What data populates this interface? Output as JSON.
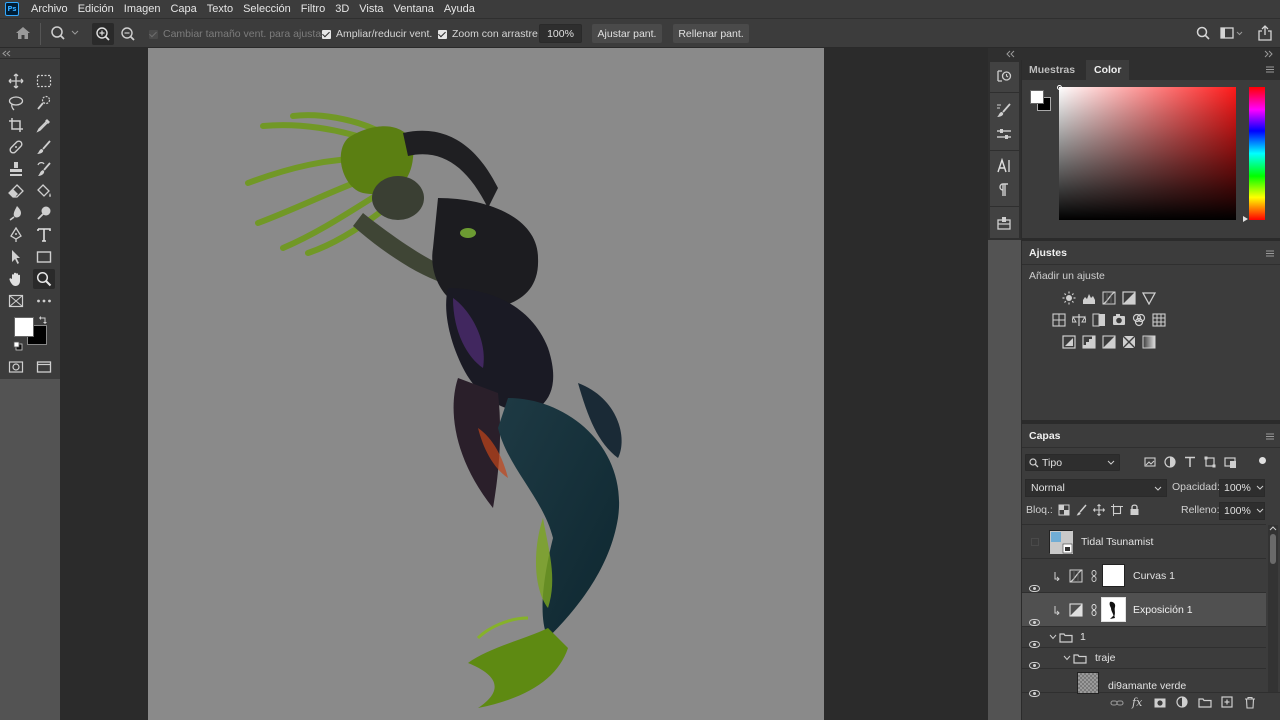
{
  "app": {
    "logo_text": "Ps"
  },
  "menu": [
    "Archivo",
    "Edición",
    "Imagen",
    "Capa",
    "Texto",
    "Selección",
    "Filtro",
    "3D",
    "Vista",
    "Ventana",
    "Ayuda"
  ],
  "options": {
    "resize_window_label": "Cambiar tamaño vent. para ajustar",
    "zoom_all_label": "Ampliar/reducir vent.",
    "scrubby_zoom_label": "Zoom con arrastre",
    "zoom_value": "100%",
    "fit_screen_label": "Ajustar pant.",
    "fill_screen_label": "Rellenar pant."
  },
  "panels": {
    "swatches_tab": "Muestras",
    "color_tab": "Color",
    "adjustments_title": "Ajustes",
    "adjustments_hint": "Añadir un ajuste",
    "layers_title": "Capas",
    "filter_kind": "Tipo",
    "blend_mode": "Normal",
    "opacity_label": "Opacidad:",
    "opacity_value": "100%",
    "lock_label": "Bloq.:",
    "fill_label": "Relleno:",
    "fill_value": "100%"
  },
  "layers": [
    {
      "name": "Tidal Tsunamist",
      "visible": false
    },
    {
      "name": "Curvas 1",
      "visible": true
    },
    {
      "name": "Exposición 1",
      "visible": true,
      "selected": true
    },
    {
      "name": "1",
      "visible": true
    },
    {
      "name": "traje",
      "visible": true
    },
    {
      "name": "di9amante verde",
      "visible": true
    }
  ],
  "colors": {
    "chrome_dark": "#3c3c3c",
    "canvas_bg": "#8a8a8a",
    "workspace_bg": "#2b2b2b",
    "selected_row": "#505050",
    "accent_red": "#ff1a1a"
  }
}
